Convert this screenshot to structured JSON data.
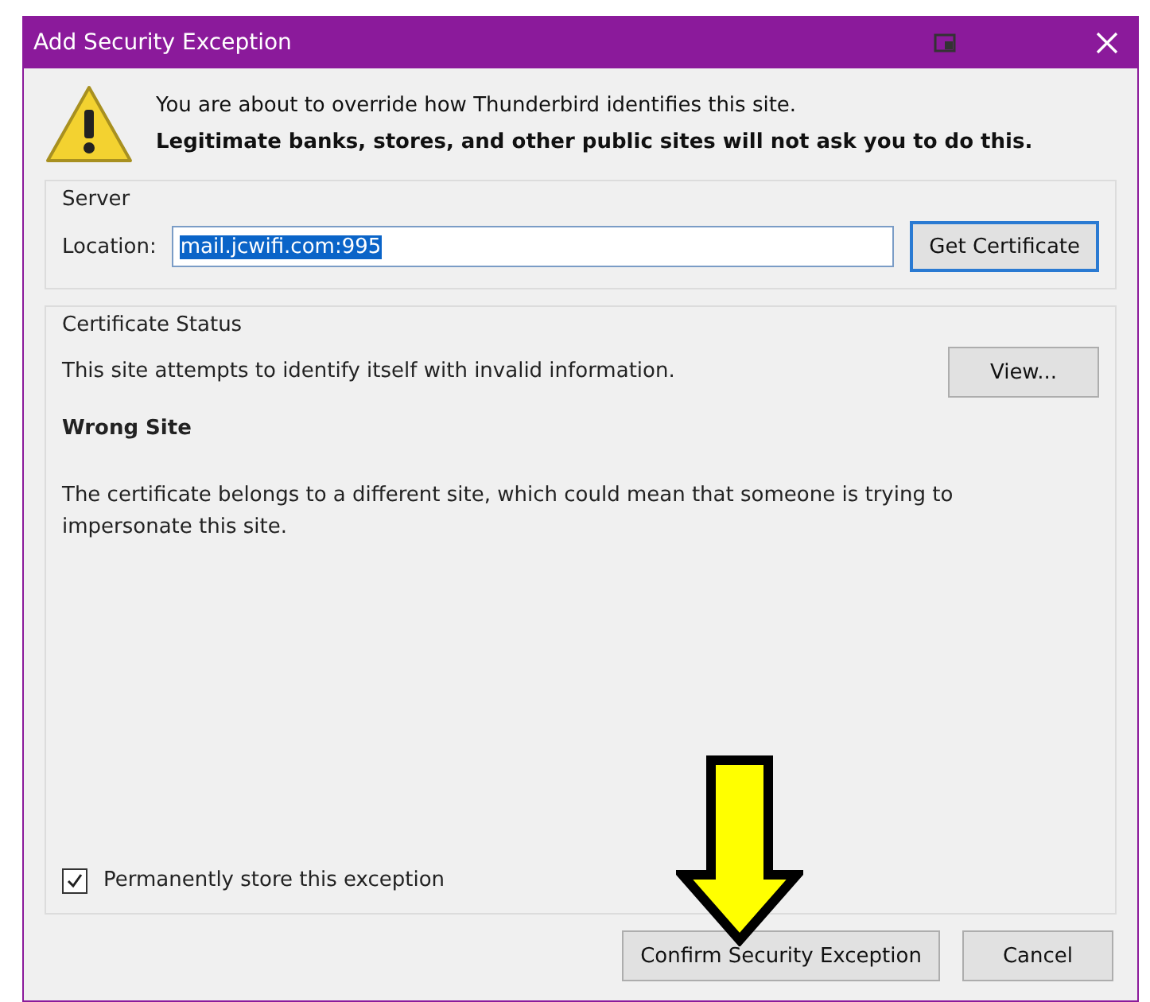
{
  "window": {
    "title": "Add Security Exception"
  },
  "intro": {
    "line": "You are about to override how Thunderbird identifies this site.",
    "warning": "Legitimate banks, stores, and other public sites will not ask you to do this."
  },
  "server": {
    "legend": "Server",
    "location_label": "Location:",
    "location_value": "mail.jcwifi.com:995",
    "get_button": "Get Certificate"
  },
  "status": {
    "legend": "Certificate Status",
    "summary": "This site attempts to identify itself with invalid information.",
    "view_button": "View...",
    "problem_title": "Wrong Site",
    "problem_text": "The certificate belongs to a different site, which could mean that someone is trying to impersonate this site."
  },
  "permanent": {
    "label": "Permanently store this exception",
    "checked": true
  },
  "buttons": [
    "Confirm Security Exception",
    "Cancel"
  ]
}
